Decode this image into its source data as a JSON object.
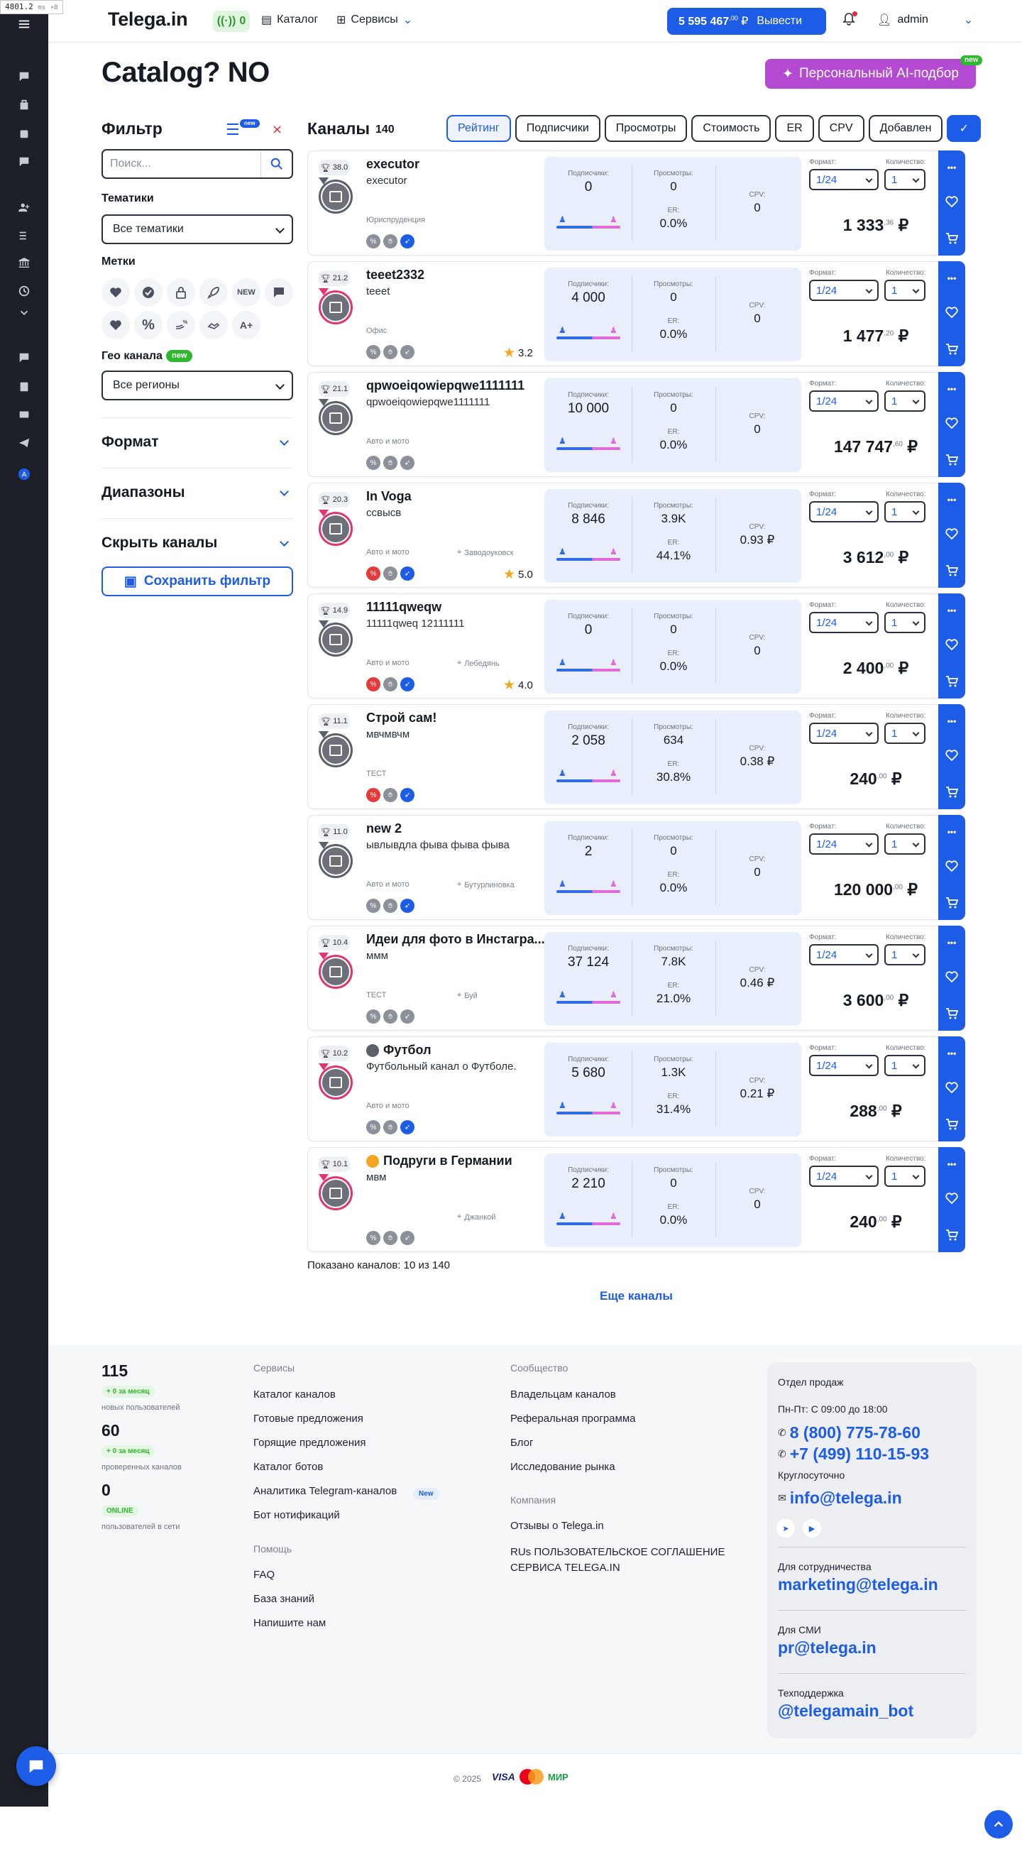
{
  "debug": {
    "fps": "4801.2",
    "unit": "ms",
    "mult": "×8"
  },
  "header": {
    "logo": "Telega.in",
    "notifications_count": "0",
    "catalog_label": "Каталог",
    "services_label": "Сервисы",
    "balance": "5 595 467",
    "balance_cents": ",00",
    "currency": "₽",
    "withdraw_label": "Вывести",
    "user_name": "admin"
  },
  "page": {
    "title": "Catalog? NO",
    "ai_button": "Персональный AI-подбор",
    "ai_badge": "new"
  },
  "filter": {
    "title": "Фильтр",
    "badge": "new",
    "search_placeholder": "Поиск...",
    "topics_label": "Тематики",
    "topics_value": "Все тематики",
    "marks_label": "Метки",
    "marks_new": "NEW",
    "marks_plus": "A+",
    "geo_label": "Гео канала",
    "geo_badge": "new",
    "geo_value": "Все регионы",
    "format_label": "Формат",
    "ranges_label": "Диапазоны",
    "hide_label": "Скрыть каналы",
    "save_label": "Сохранить фильтр"
  },
  "list": {
    "title": "Каналы",
    "count": "140",
    "sorts": [
      "Рейтинг",
      "Подписчики",
      "Просмотры",
      "Стоимость",
      "ER",
      "CPV",
      "Добавлен"
    ],
    "active_sort": "Рейтинг"
  },
  "labels": {
    "subs": "Подписчики:",
    "views": "Просмотры:",
    "er": "ER:",
    "cpv": "CPV:",
    "format": "Формат:",
    "qty": "Количество:",
    "format_value": "1/24",
    "qty_value": "1",
    "dots": "•••"
  },
  "channels": [
    {
      "rank": "38.0",
      "name": "executor",
      "desc": "executor",
      "category": "Юриспруденция",
      "geo": "",
      "rating": "",
      "subs": "0",
      "views": "0",
      "er": "0.0%",
      "cpv": "0",
      "price": "1 333",
      "cents": ",36",
      "pink": false,
      "icon": "",
      "marks": [
        "g",
        "g",
        "b"
      ]
    },
    {
      "rank": "21.2",
      "name": "teeet2332",
      "desc": "teeet",
      "category": "Офис",
      "geo": "",
      "rating": "3.2",
      "subs": "4 000",
      "views": "0",
      "er": "0.0%",
      "cpv": "0",
      "price": "1 477",
      "cents": ",20",
      "pink": true,
      "icon": "",
      "marks": [
        "g",
        "g",
        "g"
      ]
    },
    {
      "rank": "21.1",
      "name": "qpwoeiqowiepqwe1111111",
      "desc": "qpwoeiqowiepqwe1111111",
      "category": "Авто и мото",
      "geo": "",
      "rating": "",
      "subs": "10 000",
      "views": "0",
      "er": "0.0%",
      "cpv": "0",
      "price": "147 747",
      "cents": ",60",
      "pink": false,
      "icon": "",
      "marks": [
        "g",
        "g",
        "g"
      ]
    },
    {
      "rank": "20.3",
      "name": "In Voga",
      "desc": "ссвысв",
      "category": "Авто и мото",
      "geo": "Заводоуковск",
      "rating": "5.0",
      "subs": "8 846",
      "views": "3.9K",
      "er": "44.1%",
      "cpv": "0.93 ₽",
      "price": "3 612",
      "cents": ",00",
      "pink": true,
      "icon": "",
      "marks": [
        "r",
        "g",
        "b"
      ]
    },
    {
      "rank": "14.9",
      "name": "11111qweqw",
      "desc": "11111qweq 12111111",
      "category": "Авто и мото",
      "geo": "Лебедянь",
      "rating": "4.0",
      "subs": "0",
      "views": "0",
      "er": "0.0%",
      "cpv": "0",
      "price": "2 400",
      "cents": ",00",
      "pink": false,
      "icon": "",
      "marks": [
        "r",
        "g",
        "b"
      ]
    },
    {
      "rank": "11.1",
      "name": "Строй сам!",
      "desc": "мвчмвчм",
      "category": "ТЕСТ",
      "geo": "",
      "rating": "",
      "subs": "2 058",
      "views": "634",
      "er": "30.8%",
      "cpv": "0.38 ₽",
      "price": "240",
      "cents": ",00",
      "pink": false,
      "icon": "",
      "marks": [
        "r",
        "g",
        "b"
      ]
    },
    {
      "rank": "11.0",
      "name": "new 2",
      "desc": "ывлывдла фыва фыва фыва",
      "category": "Авто и мото",
      "geo": "Бутурлиновка",
      "rating": "",
      "subs": "2",
      "views": "0",
      "er": "0.0%",
      "cpv": "0",
      "price": "120 000",
      "cents": ",00",
      "pink": false,
      "icon": "",
      "marks": [
        "g",
        "g",
        "b"
      ]
    },
    {
      "rank": "10.4",
      "name": "Идеи для фото в Инстагра...",
      "desc": "ммм",
      "category": "ТЕСТ",
      "geo": "Буй",
      "rating": "",
      "subs": "37 124",
      "views": "7.8K",
      "er": "21.0%",
      "cpv": "0.46 ₽",
      "price": "3 600",
      "cents": ",00",
      "pink": true,
      "icon": "",
      "marks": [
        "g",
        "g",
        "g"
      ]
    },
    {
      "rank": "10.2",
      "name": "Футбол",
      "desc": "Футбольный канал о Футболе.",
      "category": "Авто и мото",
      "geo": "",
      "rating": "",
      "subs": "5 680",
      "views": "1.3K",
      "er": "31.4%",
      "cpv": "0.21 ₽",
      "price": "288",
      "cents": ",00",
      "pink": true,
      "icon": "g",
      "marks": [
        "g",
        "g",
        "b"
      ]
    },
    {
      "rank": "10.1",
      "name": "Подруги в Германии",
      "desc": "мвм",
      "category": "",
      "geo": "Джанкой",
      "rating": "",
      "subs": "2 210",
      "views": "0",
      "er": "0.0%",
      "cpv": "0",
      "price": "240",
      "cents": ",00",
      "pink": true,
      "icon": "y",
      "marks": [
        "g",
        "g",
        "g"
      ]
    }
  ],
  "pager": {
    "shown": "Показано каналов: 10 из 140",
    "more": "Еще каналы"
  },
  "footer": {
    "stats": [
      {
        "value": "115",
        "growth": "+ 0 за месяц",
        "label": "новых пользователей"
      },
      {
        "value": "60",
        "growth": "+ 0 за месяц",
        "label": "проверенных каналов"
      },
      {
        "value": "0",
        "growth": "ONLINE",
        "label": "пользователей в сети"
      }
    ],
    "services_title": "Сервисы",
    "services": [
      "Каталог каналов",
      "Готовые предложения",
      "Горящие предложения",
      "Каталог ботов",
      "Аналитика Telegram-каналов",
      "Бот нотификаций"
    ],
    "services_badge": "New",
    "help_title": "Помощь",
    "help": [
      "FAQ",
      "База знаний",
      "Напишите нам"
    ],
    "community_title": "Сообщество",
    "community": [
      "Владельцам каналов",
      "Реферальная программа",
      "Блог",
      "Исследование рынка"
    ],
    "company_title": "Компания",
    "company": [
      "Отзывы о Telega.in",
      "RUs ПОЛЬЗОВАТЕЛЬСКОЕ СОГЛАШЕНИЕ",
      "СЕРВИСА TELEGA.IN"
    ],
    "sales_title": "Отдел продаж",
    "hours": "Пн-Пт: С 09:00 до 18:00",
    "phone1": "8 (800) 775-78-60",
    "phone2": "+7 (499) 110-15-93",
    "around": "Круглосуточно",
    "email": "info@telega.in",
    "marketing_title": "Для сотрудничества",
    "marketing": "marketing@telega.in",
    "press_title": "Для СМИ",
    "press": "pr@telega.in",
    "support_title": "Техподдержка",
    "support": "@telegamain_bot",
    "copyright": "© 2025",
    "visa": "VISA",
    "mir": "МИР"
  },
  "colors": {
    "accent": "#1d5ce6",
    "ai": "#b34ad1",
    "rail": "#1d2028",
    "new_badge": "#2eb82e"
  }
}
